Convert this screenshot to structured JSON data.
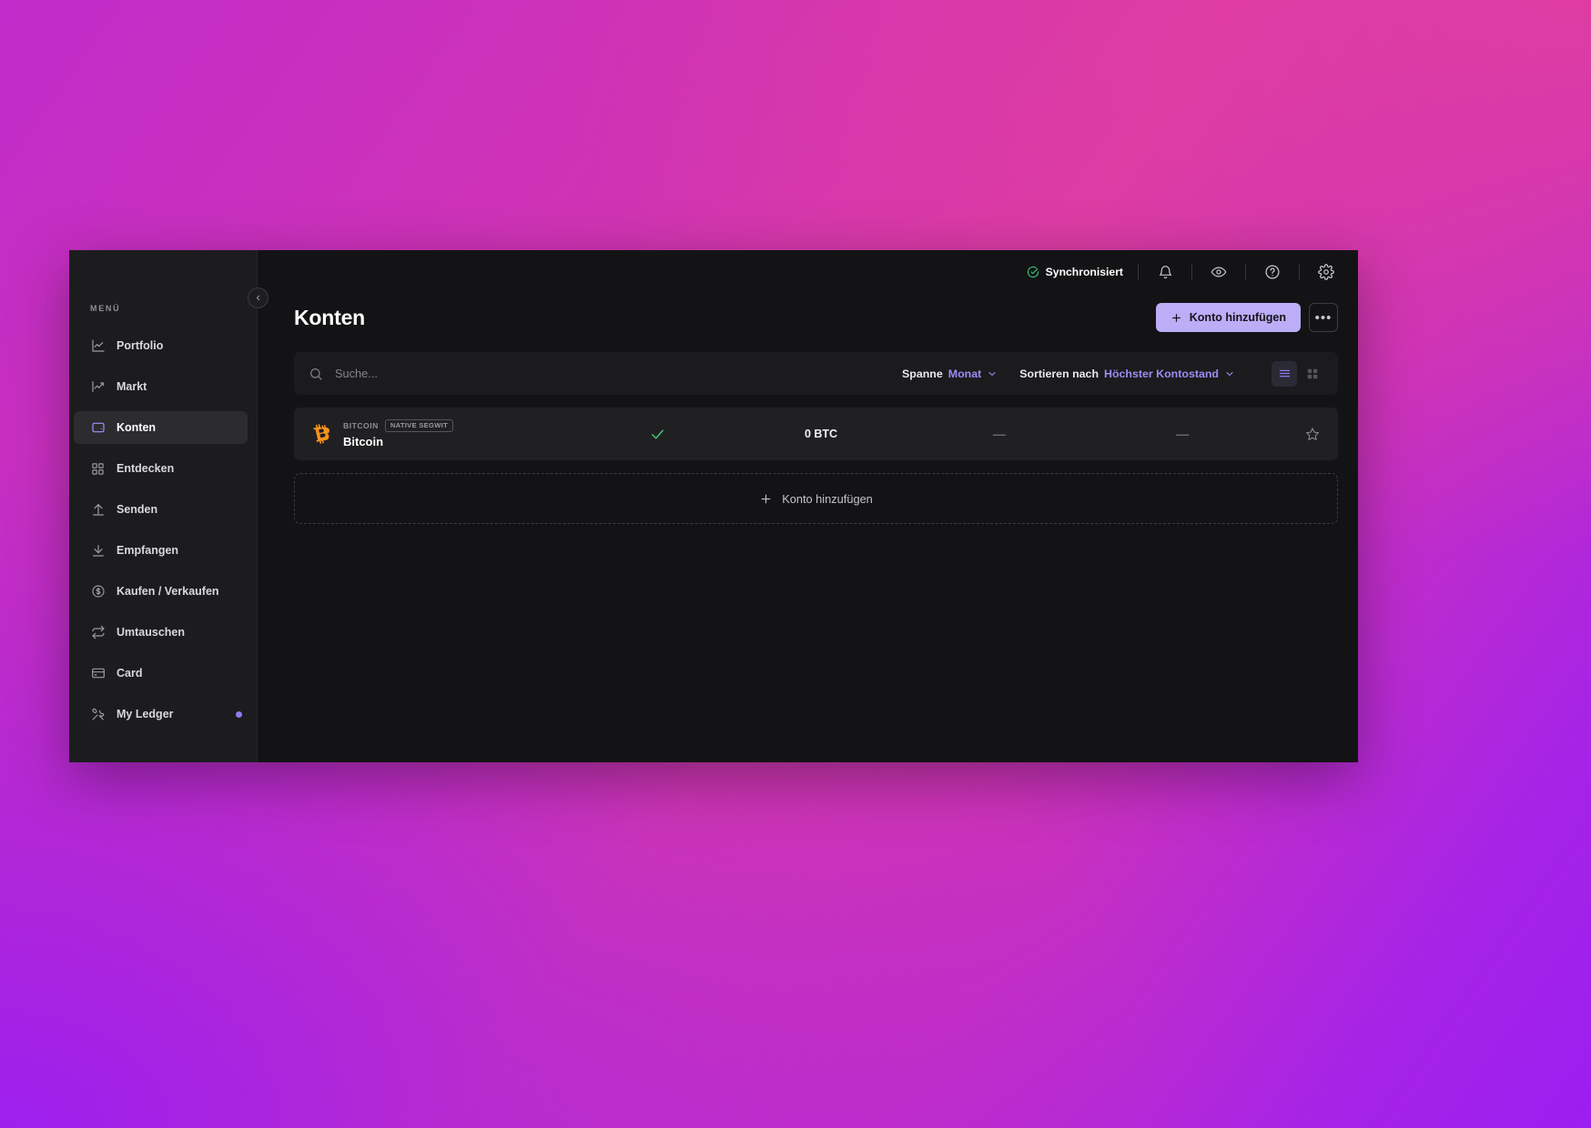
{
  "desktop": {
    "gradient_from": "#9c1fee",
    "gradient_mid": "#c42cc9",
    "gradient_to": "#db3ba5"
  },
  "sidebar": {
    "menu_label": "MENÜ",
    "collapse_icon": "chevron-left-icon",
    "items": [
      {
        "label": "Portfolio",
        "icon": "line-chart-icon",
        "active": false,
        "dot": false
      },
      {
        "label": "Markt",
        "icon": "trending-up-icon",
        "active": false,
        "dot": false
      },
      {
        "label": "Konten",
        "icon": "wallet-icon",
        "active": true,
        "dot": false
      },
      {
        "label": "Entdecken",
        "icon": "grid-icon",
        "active": false,
        "dot": false
      },
      {
        "label": "Senden",
        "icon": "arrow-up-icon",
        "active": false,
        "dot": false
      },
      {
        "label": "Empfangen",
        "icon": "arrow-down-icon",
        "active": false,
        "dot": false
      },
      {
        "label": "Kaufen / Verkaufen",
        "icon": "dollar-circle-icon",
        "active": false,
        "dot": false
      },
      {
        "label": "Umtauschen",
        "icon": "swap-icon",
        "active": false,
        "dot": false
      },
      {
        "label": "Card",
        "icon": "credit-card-icon",
        "active": false,
        "dot": false
      },
      {
        "label": "My Ledger",
        "icon": "tools-icon",
        "active": false,
        "dot": true
      }
    ],
    "dot_color": "#8f7bf0"
  },
  "topbar": {
    "sync_status": "Synchronisiert",
    "sync_color": "#39c17a",
    "icons": [
      {
        "name": "bell-icon"
      },
      {
        "name": "eye-icon"
      },
      {
        "name": "help-circle-icon"
      },
      {
        "name": "gear-icon"
      }
    ]
  },
  "page": {
    "title": "Konten",
    "add_account_label": "Konto hinzufügen",
    "more_label": "•••",
    "accent_color": "#bcadf7"
  },
  "toolbar": {
    "search_placeholder": "Suche...",
    "search_value": "",
    "search_icon": "search-icon",
    "range_label": "Spanne",
    "range_value": "Monat",
    "sort_label": "Sortieren nach",
    "sort_value": "Höchster Kontostand",
    "view_list_active": true,
    "view_list_icon": "list-view-icon",
    "view_grid_icon": "grid-view-icon"
  },
  "accounts": {
    "rows": [
      {
        "coin_icon": "bitcoin-icon",
        "coin_color": "#f7931a",
        "ticker": "BITCOIN",
        "tag": "NATIVE SEGWIT",
        "name": "Bitcoin",
        "status_icon": "check-icon",
        "status_color": "#4ac46f",
        "amount": "0 BTC",
        "countervalue": "—",
        "change": "—",
        "star_icon": "star-outline-icon"
      }
    ],
    "add_account_label": "Konto hinzufügen",
    "add_account_icon": "plus-icon"
  }
}
